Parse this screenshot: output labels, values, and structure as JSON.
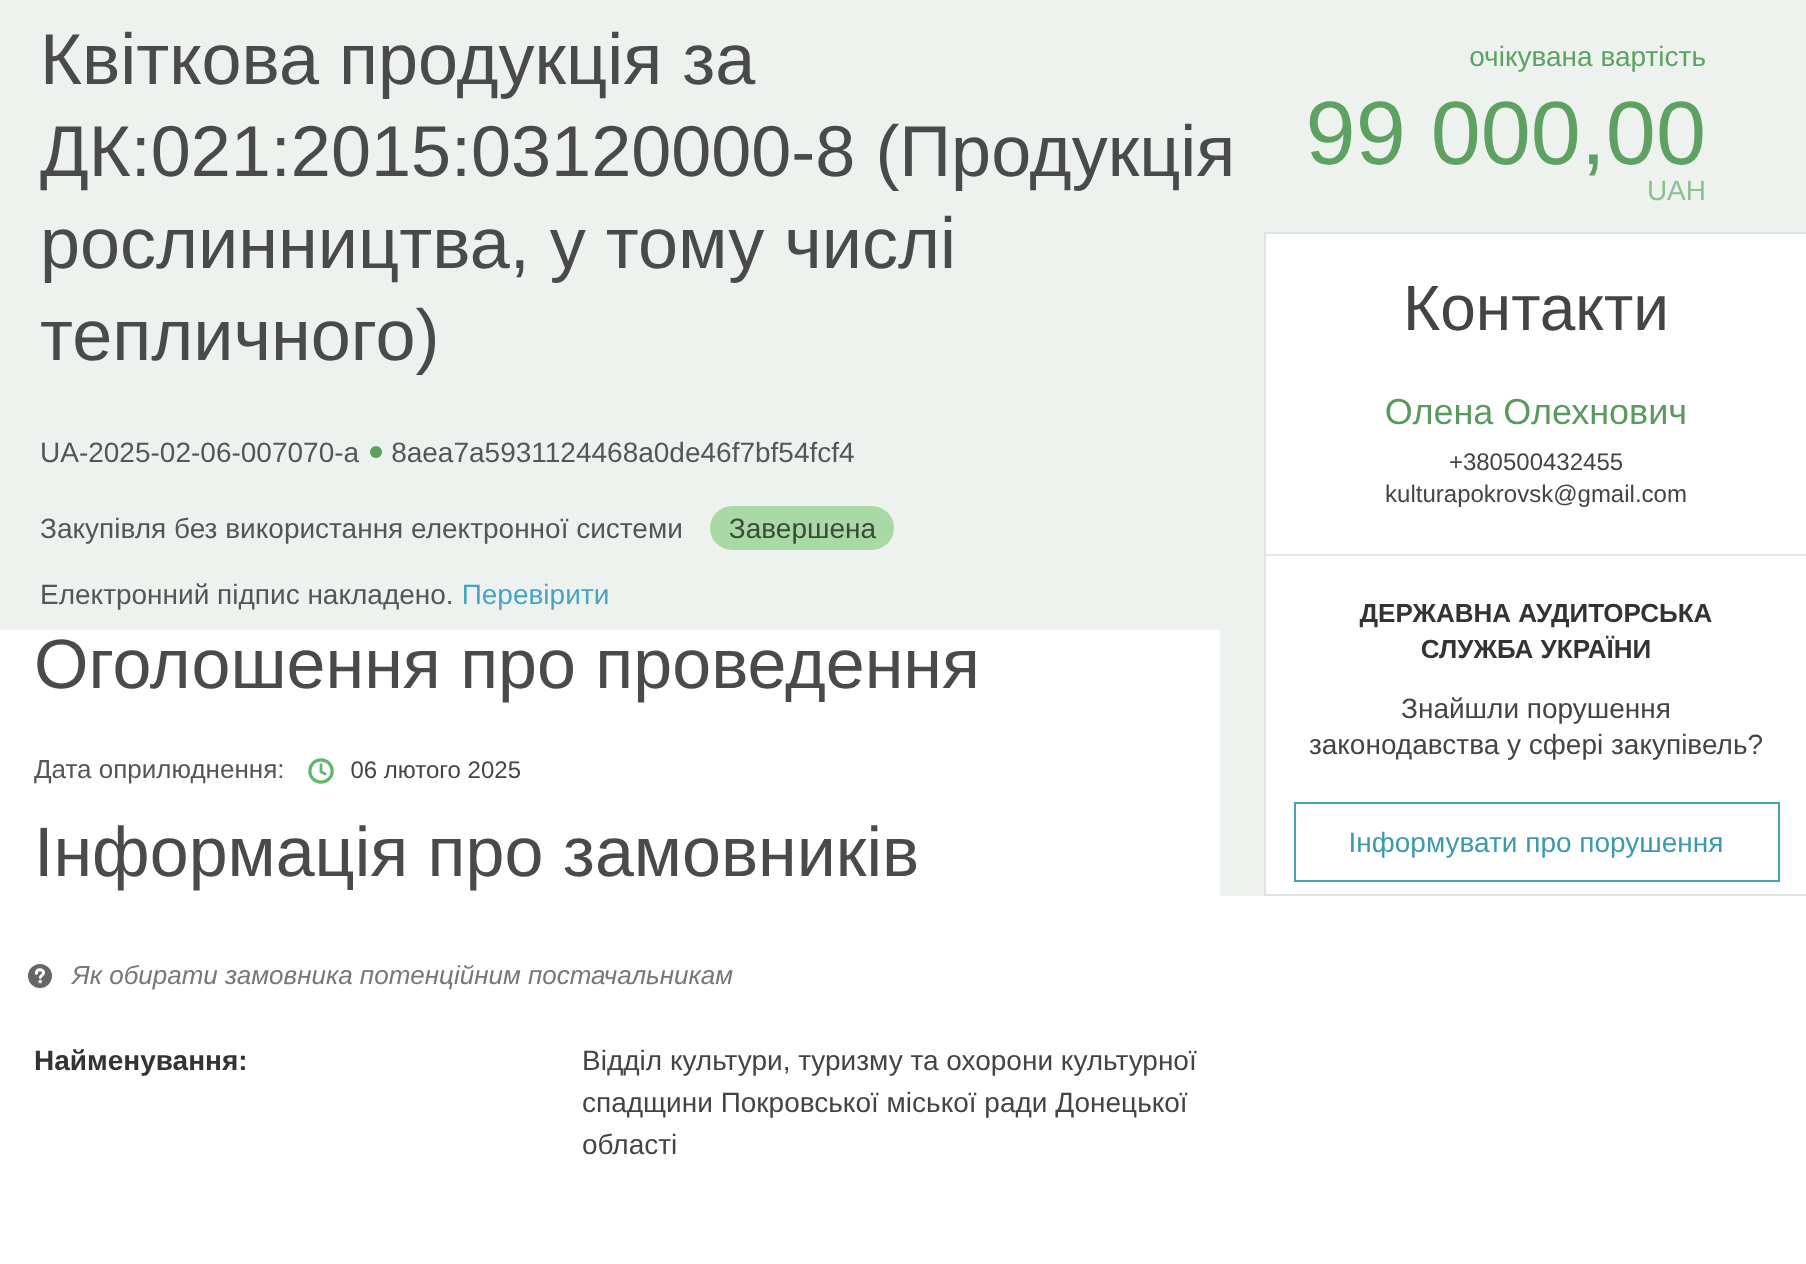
{
  "tender": {
    "title": "Квіткова продукція за ДК:021:2015:03120000-8 (Продукція рослинництва, у тому числі тепличного)",
    "id": "UA-2025-02-06-007070-a",
    "hash": "8aea7a5931124468a0de46f7bf54fcf4",
    "procedure": "Закупівля без використання електронної системи",
    "status": "Завершена",
    "signature_text": "Електронний підпис накладено.",
    "signature_link": "Перевірити"
  },
  "announcement": {
    "heading": "Оголошення про проведення",
    "date_label": "Дата оприлюднення:",
    "date": "06 лютого 2025"
  },
  "customers": {
    "heading": "Інформація про замовників",
    "help_link": "Як обирати замовника потенційним постачальникам",
    "fields": [
      {
        "label": "Найменування:",
        "value": "Відділ культури, туризму та охорони культурної спадщини Покровської міської ради Донецької області"
      }
    ]
  },
  "expected_value": {
    "label": "очікувана вартість",
    "amount": "99 000,00",
    "currency": "UAH"
  },
  "contacts": {
    "heading": "Контакти",
    "name": "Олена Олехнович",
    "phone": "+380500432455",
    "email": "kulturapokrovsk@gmail.com"
  },
  "audit": {
    "heading": "ДЕРЖАВНА АУДИТОРСЬКА СЛУЖБА УКРАЇНИ",
    "question": "Знайшли порушення\nзаконодавства у сфері закупівель?",
    "button": "Інформувати про порушення"
  }
}
